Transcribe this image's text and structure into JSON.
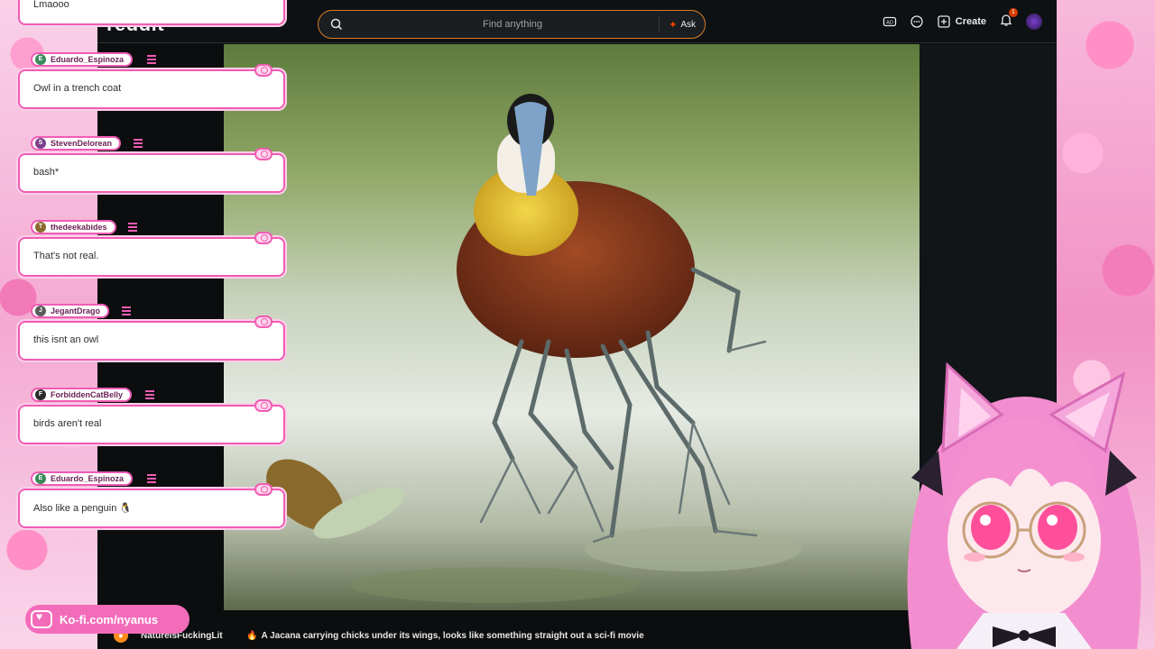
{
  "colors": {
    "accent": "#f05cb4",
    "search_border": "#d97c2a",
    "reddit_orange": "#ff4500"
  },
  "header": {
    "logo_text": "reddit",
    "search_placeholder": "Find anything",
    "ask_label": "Ask",
    "create_label": "Create",
    "notification_count": "1",
    "icons": [
      "advertise-icon",
      "chat-icon",
      "plus-icon",
      "bell-icon"
    ]
  },
  "chat": {
    "messages": [
      {
        "user": "",
        "text": "Lmaooo"
      },
      {
        "user": "Eduardo_Espinoza",
        "text": "Owl in a trench coat"
      },
      {
        "user": "StevenDelorean",
        "text": "bash*"
      },
      {
        "user": "thedeekabides",
        "text": "That's not real."
      },
      {
        "user": "JegantDrago",
        "text": "this isnt an owl"
      },
      {
        "user": "ForbiddenCatBelly",
        "text": "birds aren't real"
      },
      {
        "user": "Eduardo_Espinoza",
        "text": "Also like a penguin 🐧"
      }
    ]
  },
  "kofi": {
    "label": "Ko-fi.com/nyanus"
  },
  "post": {
    "subreddit": "NatureIsFuckingLit",
    "title": "A Jacana carrying chicks under its wings, looks like something straight out a sci-fi movie"
  }
}
